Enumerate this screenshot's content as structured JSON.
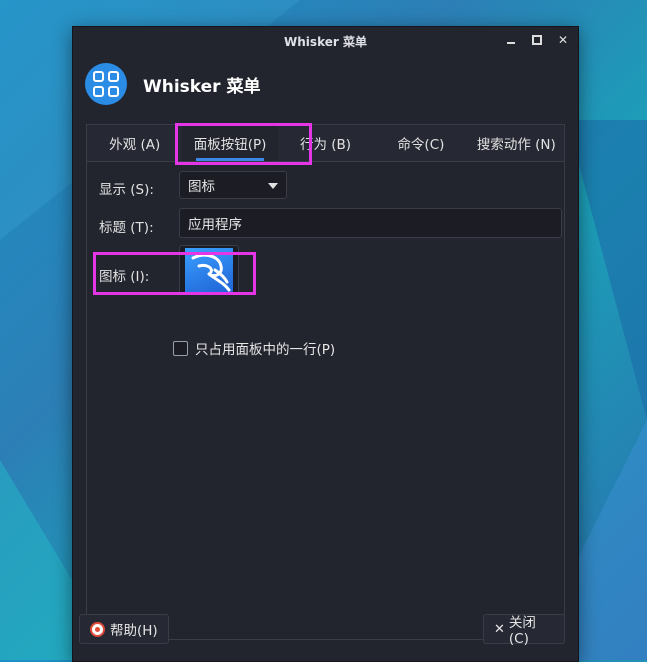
{
  "window": {
    "title": "Whisker 菜单"
  },
  "header": {
    "title": "Whisker 菜单",
    "icon": "whisker-menu-icon"
  },
  "tabs": [
    {
      "label": "外观 (A)"
    },
    {
      "label": "面板按钮(P)"
    },
    {
      "label": "行为 (B)"
    },
    {
      "label": "命令(C)"
    },
    {
      "label": "搜索动作 (N)"
    }
  ],
  "form": {
    "display_label": "显示 (S):",
    "display_value": "图标",
    "title_label": "标题 (T):",
    "title_value": "应用程序",
    "icon_label": "图标 (I):",
    "single_row_label": "只占用面板中的一行(P)",
    "single_row_checked": false
  },
  "footer": {
    "help_label": "帮助(H)",
    "close_label": "关闭(C)"
  },
  "colors": {
    "accent": "#3c87e8",
    "highlight": "#e436e7",
    "window_bg": "#22242e"
  }
}
